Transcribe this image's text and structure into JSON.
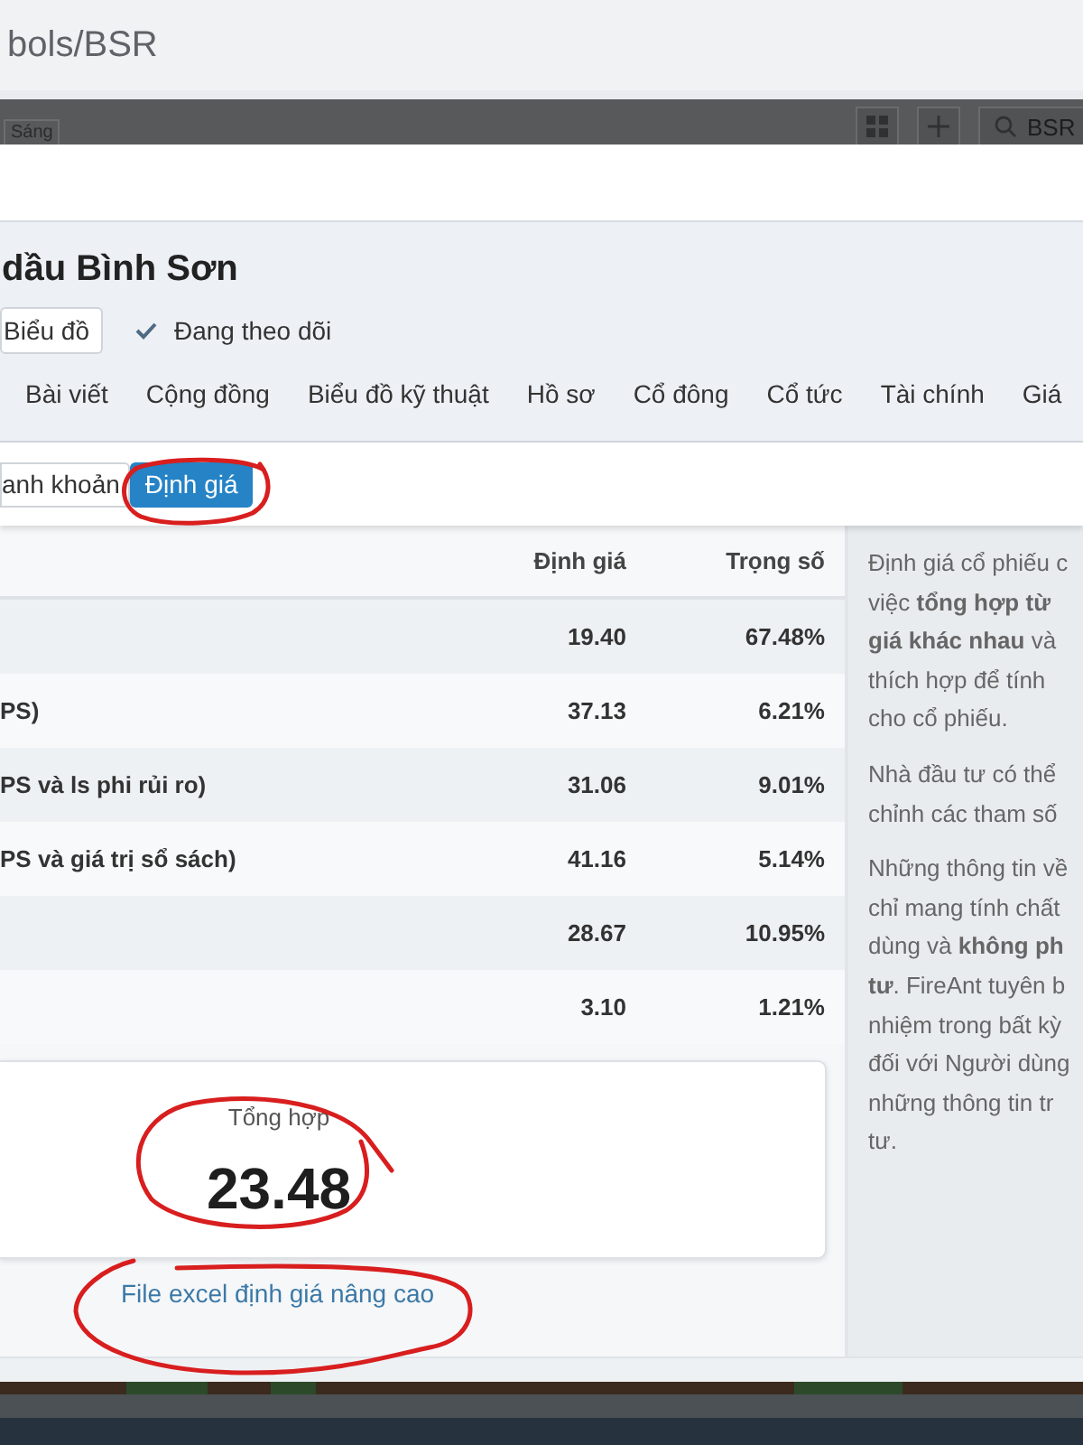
{
  "address_bar": {
    "url": "bols/BSR"
  },
  "app_header": {
    "badge": "Sáng",
    "search": {
      "value": "BSR"
    }
  },
  "company": {
    "name": "dầu Bình Sơn",
    "chart_button": "Biểu đồ",
    "follow": {
      "label": "Đang theo dõi",
      "checked": true
    }
  },
  "tabs": [
    {
      "label": "Bài viết",
      "selected": false
    },
    {
      "label": "Cộng đồng",
      "selected": false
    },
    {
      "label": "Biểu đồ kỹ thuật",
      "selected": false
    },
    {
      "label": "Hồ sơ",
      "selected": false
    },
    {
      "label": "Cổ đông",
      "selected": false
    },
    {
      "label": "Cổ tức",
      "selected": false
    },
    {
      "label": "Tài chính",
      "selected": false
    },
    {
      "label": "Giá",
      "selected": false
    }
  ],
  "sub_tabs": [
    {
      "label": "anh khoản",
      "selected": false
    },
    {
      "label": "Định giá",
      "selected": true
    }
  ],
  "valuation_table": {
    "columns": [
      "Định giá",
      "Trọng số"
    ],
    "rows": [
      {
        "value": "19.40",
        "weight": "67.48%"
      },
      {
        "method": "PS)",
        "value": "37.13",
        "weight": "6.21%"
      },
      {
        "method": "PS và ls phi rủi ro)",
        "value": "31.06",
        "weight": "9.01%"
      },
      {
        "method": "PS và giá trị sổ sách)",
        "value": "41.16",
        "weight": "5.14%"
      },
      {
        "value": "28.67",
        "weight": "10.95%"
      },
      {
        "value": "3.10",
        "weight": "1.21%"
      }
    ]
  },
  "summary": {
    "label": "Tổng hợp",
    "value": "23.48"
  },
  "excel_link": "File excel định giá nâng cao",
  "notes": [
    {
      "lines": [
        "Định giá cổ phiếu c",
        "việc **tổng hợp từ**",
        "**giá khác nhau** và",
        "thích hợp để tính",
        "cho cổ phiếu."
      ]
    },
    {
      "lines": [
        "Nhà đầu tư có thể",
        "chỉnh các tham số"
      ]
    },
    {
      "lines": [
        "Những thông tin về",
        "chỉ mang tính chất",
        "dùng và **không ph**",
        "**tư**. FireAnt tuyên b",
        "nhiệm trong bất kỳ",
        "đối với Người dùng",
        "những thông tin tr",
        "tư."
      ]
    }
  ]
}
